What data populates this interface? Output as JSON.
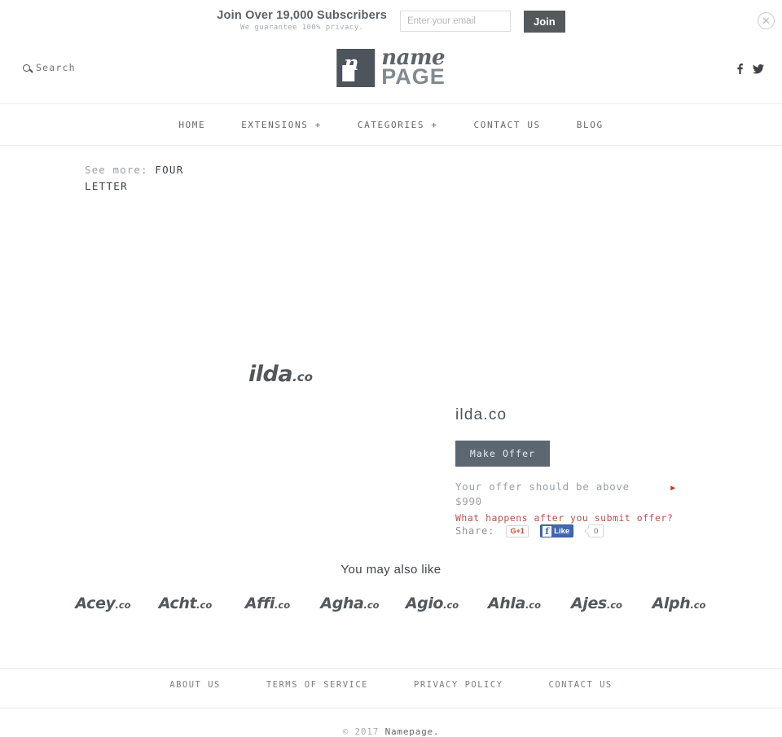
{
  "announce": {
    "title": "Join Over 19,000 Subscribers",
    "subtitle": "We guarantee 100% privacy.",
    "email_placeholder": "Enter your email",
    "email_value": "",
    "join_label": "Join",
    "close_icon": "close-circle-icon"
  },
  "header": {
    "search_label": "Search",
    "search_icon": "search-icon",
    "logo": {
      "mark_letter": "n",
      "name": "name",
      "page": "PAGE"
    },
    "socials": [
      {
        "name": "facebook-icon",
        "glyph": "f"
      },
      {
        "name": "twitter-icon",
        "glyph": "twitter"
      }
    ]
  },
  "mainnav": {
    "items": [
      {
        "label": "HOME"
      },
      {
        "label": "EXTENSIONS +"
      },
      {
        "label": "CATEGORIES +"
      },
      {
        "label": "CONTACT US"
      },
      {
        "label": "BLOG"
      }
    ]
  },
  "breadcrumb": {
    "label": "See more:",
    "link": "FOUR LETTER"
  },
  "product": {
    "logo_name": "ilda",
    "logo_tld": ".co",
    "title": "ilda.co",
    "make_offer_label": "Make Offer",
    "offer_note": "Your offer should be above $990",
    "offer_minimum": "$990",
    "offer_arrow_icon": "arrow-right-icon",
    "offer_help_link": "What happens after you submit offer?"
  },
  "share": {
    "label": "Share:",
    "gplus_label": "G+1",
    "facebook_label": "Like",
    "facebook_f": "f",
    "facebook_count": "0"
  },
  "also_like": {
    "title": "You may also like",
    "items": [
      {
        "name": "Acey",
        "tld": ".co"
      },
      {
        "name": "Acht",
        "tld": ".co"
      },
      {
        "name": "Affi",
        "tld": ".co"
      },
      {
        "name": "Agha",
        "tld": ".co"
      },
      {
        "name": "Agio",
        "tld": ".co"
      },
      {
        "name": "Ahla",
        "tld": ".co"
      },
      {
        "name": "Ajes",
        "tld": ".co"
      },
      {
        "name": "Alph",
        "tld": ".co"
      }
    ]
  },
  "footer": {
    "links": [
      {
        "label": "ABOUT US"
      },
      {
        "label": "TERMS OF SERVICE"
      },
      {
        "label": "PRIVACY POLICY"
      },
      {
        "label": "CONTACT US"
      }
    ],
    "copyright_prefix": "© 2017 ",
    "copyright_brand": "Namepage."
  },
  "colors": {
    "accent_button": "#5d6772",
    "link_red": "#b5534c",
    "facebook_blue": "#4267b2",
    "gplus_red": "#d34836",
    "text_muted": "#9ba0a4"
  }
}
